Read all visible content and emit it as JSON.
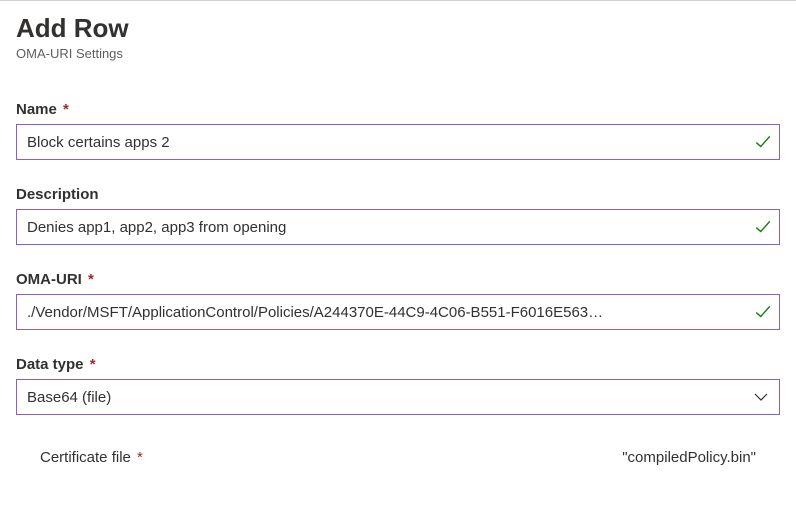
{
  "header": {
    "title": "Add Row",
    "subtitle": "OMA-URI Settings"
  },
  "form": {
    "name": {
      "label": "Name",
      "required_marker": "*",
      "value": "Block certains apps 2",
      "valid": true
    },
    "description": {
      "label": "Description",
      "value": "Denies app1, app2, app3 from opening",
      "valid": true
    },
    "oma_uri": {
      "label": "OMA-URI",
      "required_marker": "*",
      "value": "./Vendor/MSFT/ApplicationControl/Policies/A244370E-44C9-4C06-B551-F6016E563…",
      "valid": true
    },
    "data_type": {
      "label": "Data type",
      "required_marker": "*",
      "value": "Base64 (file)"
    },
    "certificate_file": {
      "label": "Certificate file",
      "required_marker": "*",
      "value": "\"compiledPolicy.bin\""
    }
  },
  "colors": {
    "border": "#8661c5",
    "success": "#107c10",
    "required": "#a4262c"
  }
}
